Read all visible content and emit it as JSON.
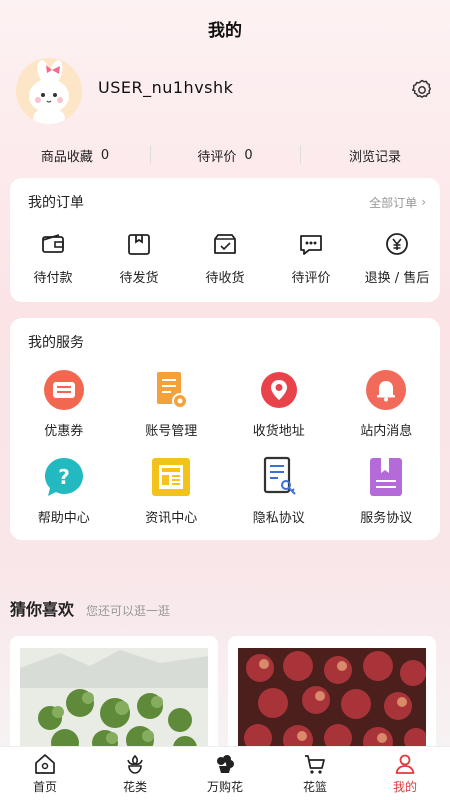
{
  "header": {
    "title": "我的"
  },
  "profile": {
    "username": "USER_nu1hvshk"
  },
  "stats": [
    {
      "label": "商品收藏",
      "value": "0"
    },
    {
      "label": "待评价",
      "value": "0"
    },
    {
      "label": "浏览记录",
      "value": ""
    }
  ],
  "orders": {
    "title": "我的订单",
    "more": "全部订单",
    "items": [
      {
        "label": "待付款",
        "icon": "wallet-icon"
      },
      {
        "label": "待发货",
        "icon": "package-icon"
      },
      {
        "label": "待收货",
        "icon": "truck-box-icon"
      },
      {
        "label": "待评价",
        "icon": "chat-bubble-icon"
      },
      {
        "label": "退换 / 售后",
        "icon": "yuan-refund-icon"
      }
    ]
  },
  "services": {
    "title": "我的服务",
    "items": [
      {
        "label": "优惠券",
        "icon": "coupon-icon",
        "color": "#f2674f"
      },
      {
        "label": "账号管理",
        "icon": "account-doc-icon",
        "color": "#f5a13a"
      },
      {
        "label": "收货地址",
        "icon": "location-pin-icon",
        "color": "#e8424a"
      },
      {
        "label": "站内消息",
        "icon": "bell-icon",
        "color": "#f16a5a"
      },
      {
        "label": "帮助中心",
        "icon": "question-bubble-icon",
        "color": "#22b9c0"
      },
      {
        "label": "资讯中心",
        "icon": "news-icon",
        "color": "#f3c21b"
      },
      {
        "label": "隐私协议",
        "icon": "privacy-doc-icon",
        "color": "#3c6fd8"
      },
      {
        "label": "服务协议",
        "icon": "bookmark-book-icon",
        "color": "#b46ad9"
      }
    ]
  },
  "guess": {
    "title": "猜你喜欢",
    "subtitle": "您还可以逛一逛"
  },
  "tabbar": {
    "items": [
      {
        "label": "首页",
        "icon": "home-icon",
        "active": false
      },
      {
        "label": "花类",
        "icon": "flower-icon",
        "active": false
      },
      {
        "label": "万购花",
        "icon": "flower-pot-icon",
        "active": false
      },
      {
        "label": "花篮",
        "icon": "cart-icon",
        "active": false
      },
      {
        "label": "我的",
        "icon": "user-icon",
        "active": true
      }
    ]
  },
  "colors": {
    "accent": "#e03a3e",
    "background": "#fbe3e6"
  }
}
